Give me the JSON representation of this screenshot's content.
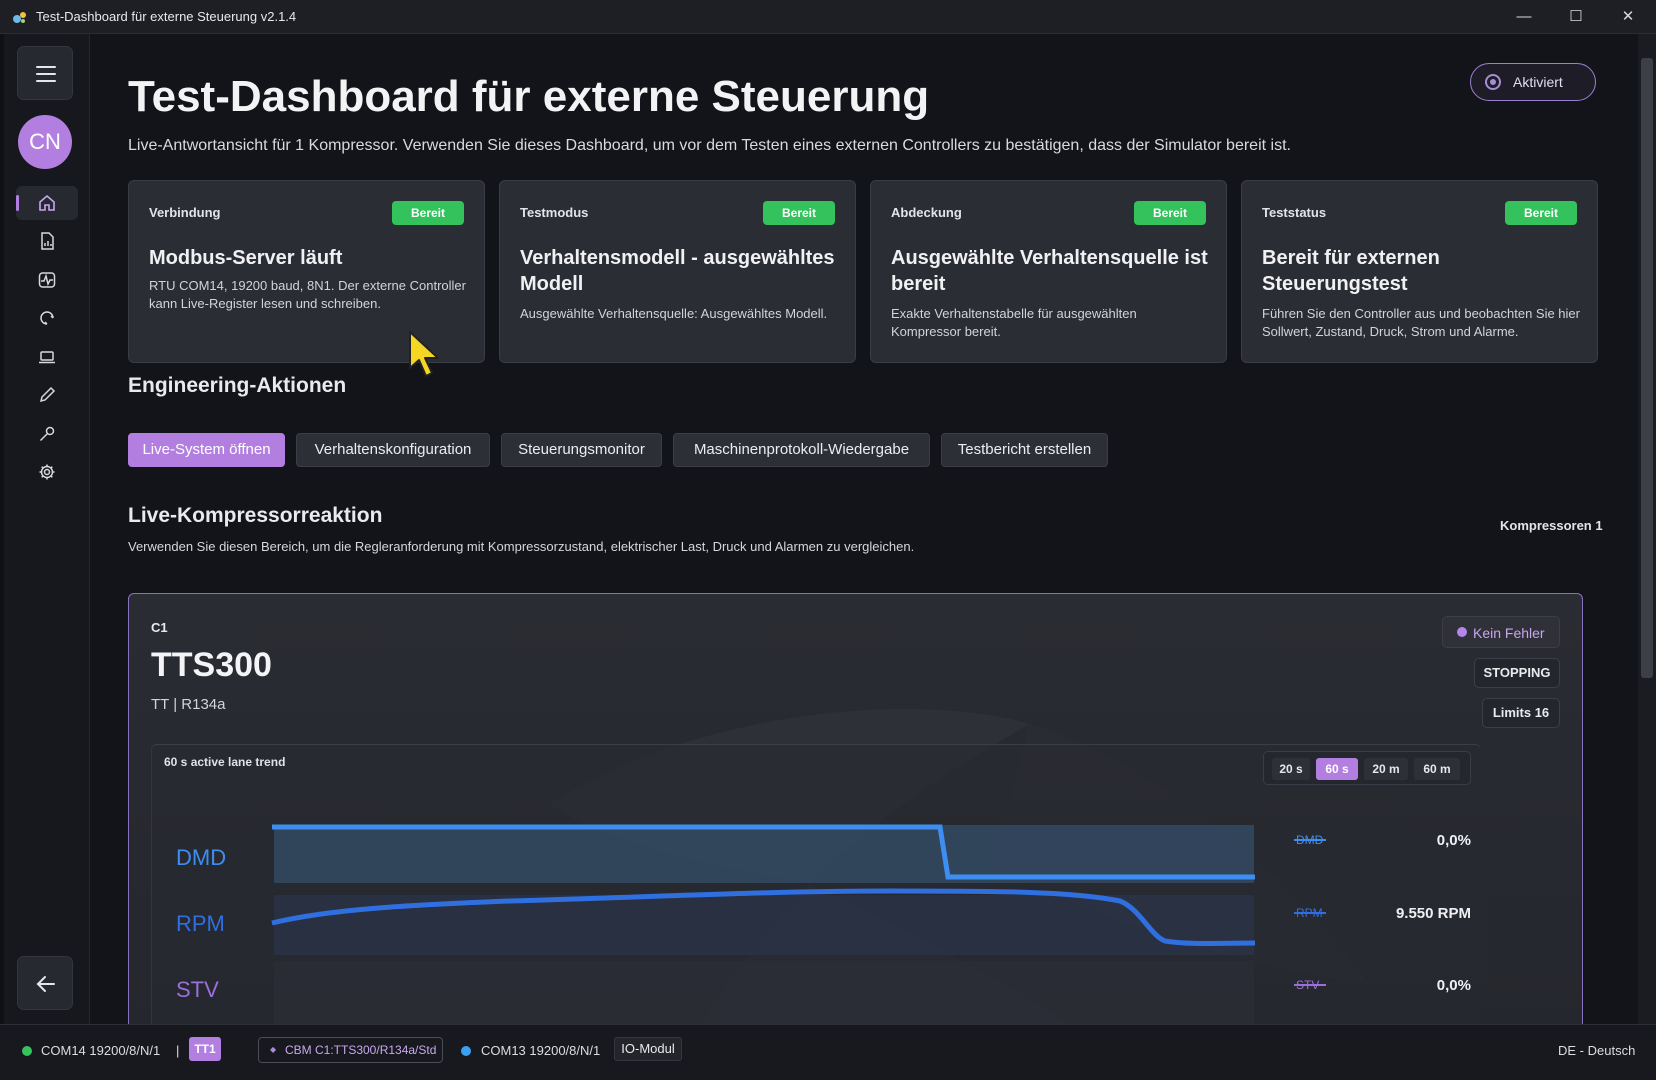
{
  "window": {
    "title": "Test-Dashboard für externe Steuerung v2.1.4",
    "minimize": "—",
    "maximize": "☐",
    "close": "✕"
  },
  "sidebar": {
    "avatar": "CN",
    "items": [
      {
        "name": "home-icon",
        "active": true
      },
      {
        "name": "document-chart-icon",
        "active": false
      },
      {
        "name": "activity-icon",
        "active": false
      },
      {
        "name": "refresh-icon",
        "active": false
      },
      {
        "name": "laptop-icon",
        "active": false
      },
      {
        "name": "pen-icon",
        "active": false
      },
      {
        "name": "wrench-icon",
        "active": false
      },
      {
        "name": "gear-icon",
        "active": false
      }
    ]
  },
  "header": {
    "title": "Test-Dashboard für externe Steuerung",
    "subtitle": "Live-Antwortansicht für 1 Kompressor. Verwenden Sie dieses Dashboard, um vor dem Testen eines externen Controllers zu bestätigen, dass der Simulator bereit ist.",
    "activated": "Aktiviert"
  },
  "cards": [
    {
      "label": "Verbindung",
      "badge": "Bereit",
      "title": "Modbus-Server läuft",
      "desc": "RTU COM14, 19200 baud, 8N1. Der externe Controller kann Live-Register lesen und schreiben."
    },
    {
      "label": "Testmodus",
      "badge": "Bereit",
      "title": "Verhaltensmodell - ausgewähltes Modell",
      "desc": "Ausgewählte Verhaltensquelle: Ausgewähltes Modell."
    },
    {
      "label": "Abdeckung",
      "badge": "Bereit",
      "title": "Ausgewählte Verhaltensquelle ist bereit",
      "desc": "Exakte Verhaltenstabelle für ausgewählten Kompressor bereit."
    },
    {
      "label": "Teststatus",
      "badge": "Bereit",
      "title": "Bereit für externen Steuerungstest",
      "desc": "Führen Sie den Controller aus und beobachten Sie hier Sollwert, Zustand, Druck, Strom und Alarme."
    }
  ],
  "engineering": {
    "heading": "Engineering-Aktionen",
    "actions": [
      "Live-System öffnen",
      "Verhaltenskonfiguration",
      "Steuerungsmonitor",
      "Maschinenprotokoll-Wiedergabe",
      "Testbericht erstellen"
    ]
  },
  "live": {
    "heading": "Live-Kompressorreaktion",
    "subtitle": "Verwenden Sie diesen Bereich, um die Regleranforderung mit Kompressorzustand, elektrischer Last, Druck und Alarmen zu vergleichen.",
    "count": "Kompressoren 1",
    "compressor": {
      "id": "C1",
      "model": "TTS300",
      "meta": "TT  |  R134a",
      "fault": "Kein Fehler",
      "state": "STOPPING",
      "limits": "Limits 16"
    },
    "trend": {
      "title": "60 s active lane trend",
      "ranges": [
        "20 s",
        "60 s",
        "20 m",
        "60 m"
      ],
      "selected_range": "60 s",
      "lanes": [
        {
          "label": "DMD",
          "legend": "DMD",
          "value": "0,0%",
          "color": "#3d8ef0"
        },
        {
          "label": "RPM",
          "legend": "RPM",
          "value": "9.550 RPM",
          "color": "#2f6fe0"
        },
        {
          "label": "STV",
          "legend": "STV",
          "value": "0,0%",
          "color": "#9b6fd8"
        }
      ]
    }
  },
  "statusbar": {
    "port1": "COM14 19200/8/N/1",
    "sep": "|",
    "tag": "TT1",
    "cbm": "CBM C1:TTS300/R134a/Std",
    "port2": "COM13 19200/8/N/1",
    "io": "IO-Modul",
    "locale": "DE - Deutsch",
    "colors": {
      "port1": "#35c35a",
      "port2": "#3aa0f0"
    }
  }
}
